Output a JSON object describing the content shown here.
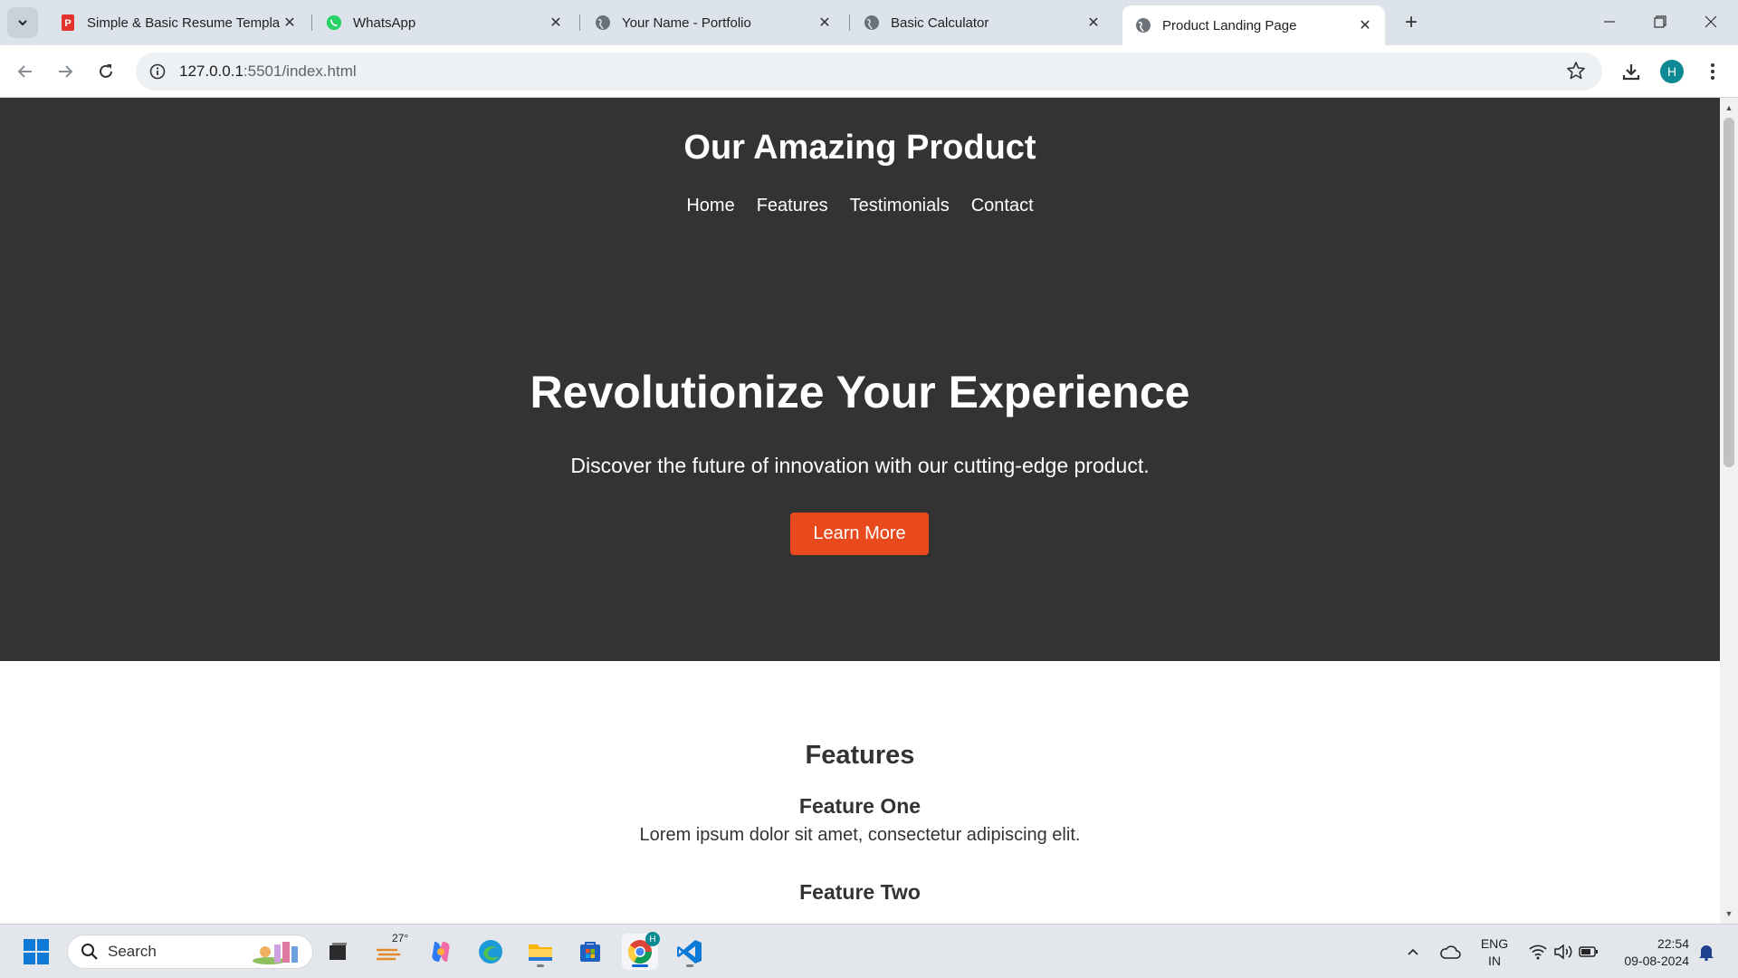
{
  "browser": {
    "tabs": [
      {
        "title": "Simple & Basic Resume Templa",
        "icon": "pdf-icon",
        "active": false
      },
      {
        "title": "WhatsApp",
        "icon": "whatsapp-icon",
        "active": false
      },
      {
        "title": "Your Name - Portfolio",
        "icon": "globe-icon",
        "active": false
      },
      {
        "title": "Basic Calculator",
        "icon": "globe-icon",
        "active": false
      },
      {
        "title": "Product Landing Page",
        "icon": "globe-icon",
        "active": true
      }
    ],
    "url_host": "127.0.0.1",
    "url_rest": ":5501/index.html",
    "profile_initial": "H",
    "accent_color": "#0b8a94"
  },
  "page": {
    "site_title": "Our Amazing Product",
    "nav": [
      "Home",
      "Features",
      "Testimonials",
      "Contact"
    ],
    "hero_heading": "Revolutionize Your Experience",
    "hero_text": "Discover the future of innovation with our cutting-edge product.",
    "cta_label": "Learn More",
    "cta_color": "#e8491d",
    "hero_bg": "#333333",
    "features_heading": "Features",
    "features": [
      {
        "title": "Feature One",
        "text": "Lorem ipsum dolor sit amet, consectetur adipiscing elit."
      },
      {
        "title": "Feature Two"
      }
    ]
  },
  "taskbar": {
    "search_label": "Search",
    "weather_temp": "27°",
    "lang_line1": "ENG",
    "lang_line2": "IN",
    "time": "22:54",
    "date": "09-08-2024"
  }
}
